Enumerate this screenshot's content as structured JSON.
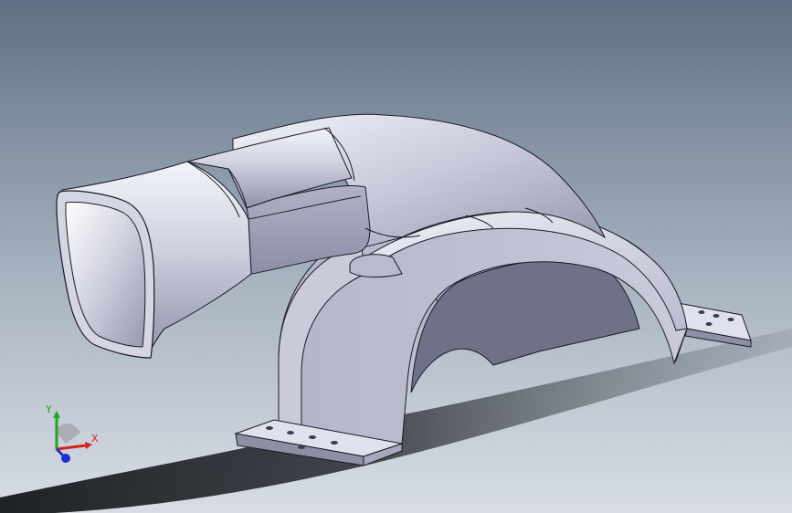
{
  "triad": {
    "x_label": "X",
    "y_label": "Y",
    "colors": {
      "x_axis": "#d42020",
      "y_axis": "#1fa51f",
      "z_axis": "#1e2fd2"
    }
  },
  "colors": {
    "background_top": "#5f7085",
    "background_bottom": "#d5dbe2",
    "part_body": "#c3c4d4",
    "part_highlight": "#eef0f8",
    "part_shadow": "#8a8ca3",
    "floor_shadow": "#1c1f24",
    "edge_line": "#1a1a22"
  }
}
